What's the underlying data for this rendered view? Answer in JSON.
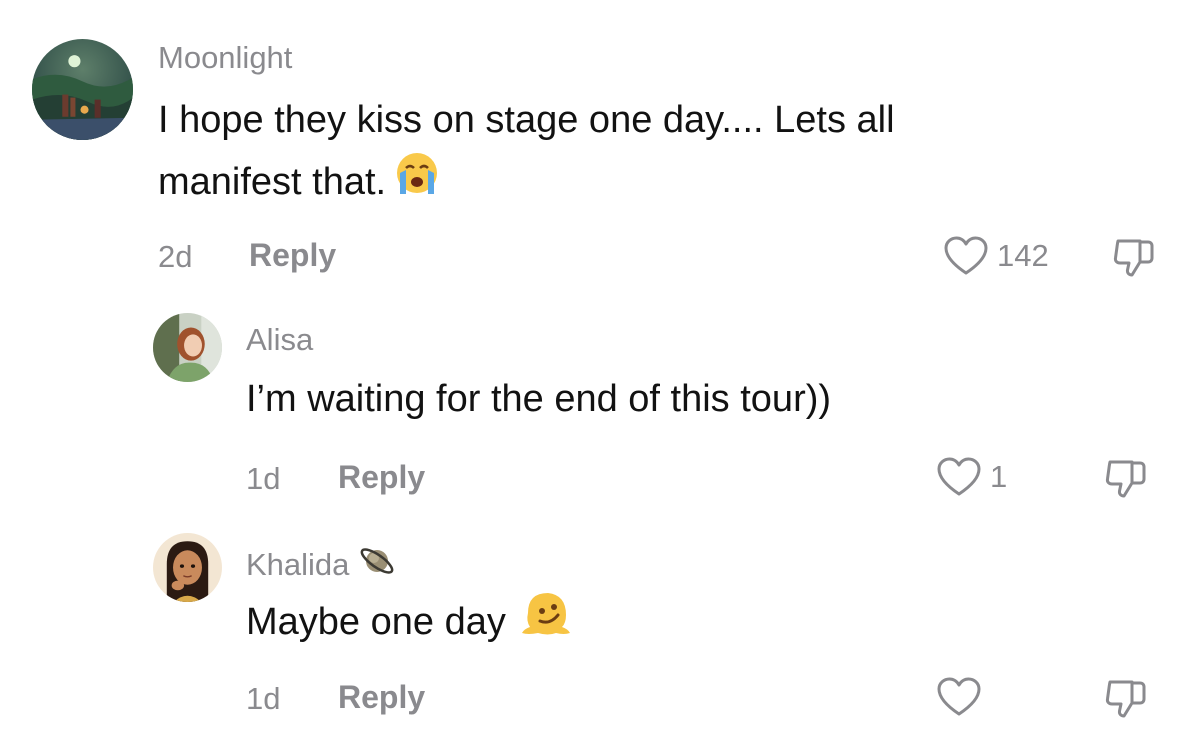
{
  "comments": [
    {
      "username": "Moonlight",
      "text_line1": "I hope they kiss on stage one day.... Lets all",
      "text_line2": "manifest that.",
      "text_emoji": "crying-face",
      "age": "2d",
      "reply_label": "Reply",
      "likes": "142",
      "avatar": "night-landscape"
    },
    {
      "username": "Alisa",
      "text_line1": "I’m waiting for the end of this tour))",
      "age": "1d",
      "reply_label": "Reply",
      "likes": "1",
      "avatar": "person-photo"
    },
    {
      "username": "Khalida",
      "username_emoji": "ringed-planet",
      "text_line1": "Maybe one day",
      "text_emoji": "melting-face",
      "age": "1d",
      "reply_label": "Reply",
      "likes": "",
      "avatar": "illustrated-girl"
    }
  ],
  "colors": {
    "meta_gray": "#8a8a8e",
    "text": "#121212",
    "background": "#ffffff"
  },
  "icons": {
    "like": "heart-outline-icon",
    "dislike": "thumbs-down-outline-icon"
  }
}
